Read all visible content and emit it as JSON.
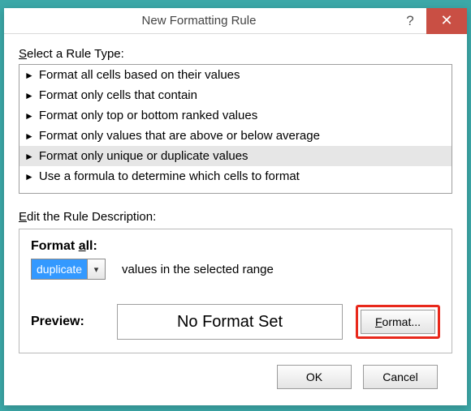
{
  "window": {
    "title": "New Formatting Rule",
    "help_symbol": "?",
    "close_symbol": "✕"
  },
  "rule_type": {
    "label_prefix": "S",
    "label_rest": "elect a Rule Type:",
    "items": [
      "Format all cells based on their values",
      "Format only cells that contain",
      "Format only top or bottom ranked values",
      "Format only values that are above or below average",
      "Format only unique or duplicate values",
      "Use a formula to determine which cells to format"
    ],
    "selected_index": 4
  },
  "edit": {
    "label_prefix": "E",
    "label_rest": "dit the Rule Description:",
    "format_all_prefix": "F",
    "format_all_mid": "ormat ",
    "format_all_u": "a",
    "format_all_end": "ll:",
    "combo_value": "duplicate",
    "range_text": "values in the selected range",
    "preview_label": "Preview:",
    "preview_text": "No Format Set",
    "format_button_u": "F",
    "format_button_rest": "ormat..."
  },
  "footer": {
    "ok": "OK",
    "cancel": "Cancel"
  }
}
